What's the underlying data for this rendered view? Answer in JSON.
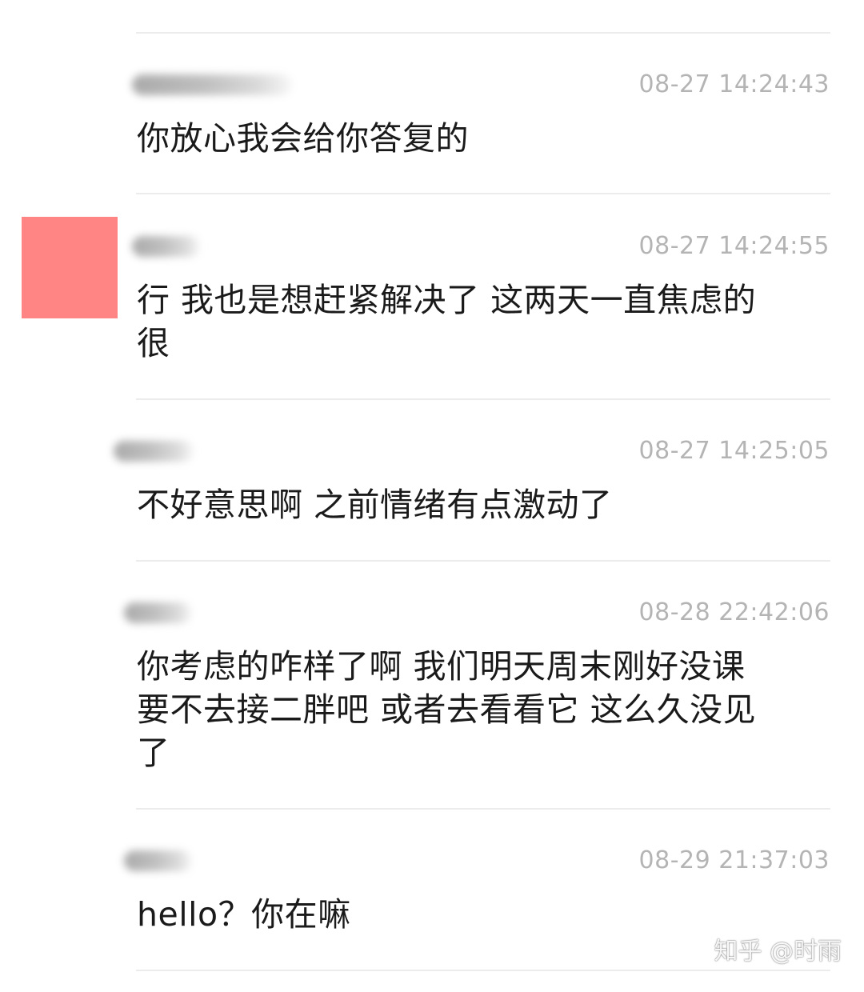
{
  "messages": [
    {
      "time": "08-27 14:24:43",
      "text": "你放心我会给你答复的"
    },
    {
      "time": "08-27 14:24:55",
      "text": "行 我也是想赶紧解决了 这两天一直焦虑的\n很"
    },
    {
      "time": "08-27 14:25:05",
      "text": "不好意思啊 之前情绪有点激动了"
    },
    {
      "time": "08-28 22:42:06",
      "text": "你考虑的咋样了啊 我们明天周末刚好没课\n要不去接二胖吧 或者去看看它 这么久没见\n了"
    },
    {
      "time": "08-29 21:37:03",
      "text": "hello？你在嘛"
    }
  ],
  "colors": {
    "avatar": "#ff8585",
    "timestamp": "#b4b4b4",
    "message_text": "#1a1a1a",
    "divider": "#ececec"
  },
  "watermark": "知乎 @时雨"
}
